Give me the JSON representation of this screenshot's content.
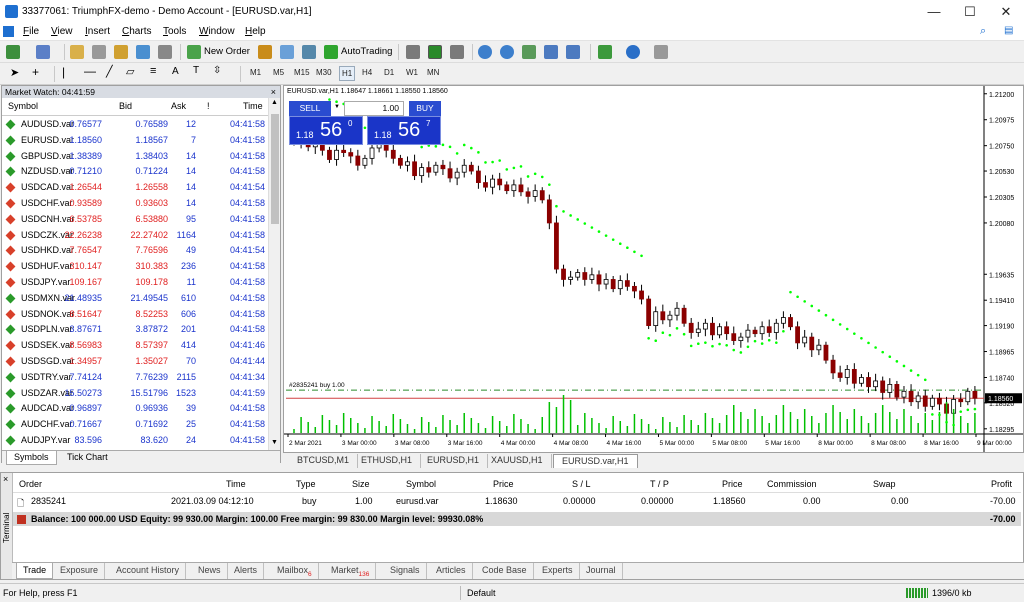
{
  "window": {
    "title": "33377061: TriumphFX-demo - Demo Account - [EURUSD.var,H1]",
    "minimize": "—",
    "maximize": "☐",
    "close": "✕"
  },
  "menu": [
    "File",
    "View",
    "Insert",
    "Charts",
    "Tools",
    "Window",
    "Help"
  ],
  "toolbar": {
    "new_order": "New Order",
    "autotrading": "AutoTrading"
  },
  "timeframes": [
    "M1",
    "M5",
    "M15",
    "M30",
    "H1",
    "H4",
    "D1",
    "W1",
    "MN"
  ],
  "market_watch": {
    "title": "Market Watch: 04:41:59",
    "close": "×",
    "columns": {
      "symbol": "Symbol",
      "bid": "Bid",
      "ask": "Ask",
      "excl": "!",
      "time": "Time"
    },
    "rows": [
      {
        "symbol": "AUDUSD.var",
        "bid": "0.76577",
        "ask": "0.76589",
        "spread": "12",
        "time": "04:41:58",
        "dir": "up"
      },
      {
        "symbol": "EURUSD.var",
        "bid": "1.18560",
        "ask": "1.18567",
        "spread": "7",
        "time": "04:41:58",
        "dir": "up"
      },
      {
        "symbol": "GBPUSD.var",
        "bid": "1.38389",
        "ask": "1.38403",
        "spread": "14",
        "time": "04:41:58",
        "dir": "up"
      },
      {
        "symbol": "NZDUSD.var",
        "bid": "0.71210",
        "ask": "0.71224",
        "spread": "14",
        "time": "04:41:58",
        "dir": "up"
      },
      {
        "symbol": "USDCAD.var",
        "bid": "1.26544",
        "ask": "1.26558",
        "spread": "14",
        "time": "04:41:54",
        "dir": "dn"
      },
      {
        "symbol": "USDCHF.var",
        "bid": "0.93589",
        "ask": "0.93603",
        "spread": "14",
        "time": "04:41:58",
        "dir": "dn"
      },
      {
        "symbol": "USDCNH.var",
        "bid": "6.53785",
        "ask": "6.53880",
        "spread": "95",
        "time": "04:41:58",
        "dir": "dn"
      },
      {
        "symbol": "USDCZK.var",
        "bid": "22.26238",
        "ask": "22.27402",
        "spread": "1164",
        "time": "04:41:58",
        "dir": "dn"
      },
      {
        "symbol": "USDHKD.var",
        "bid": "7.76547",
        "ask": "7.76596",
        "spread": "49",
        "time": "04:41:54",
        "dir": "dn"
      },
      {
        "symbol": "USDHUF.var",
        "bid": "310.147",
        "ask": "310.383",
        "spread": "236",
        "time": "04:41:58",
        "dir": "dn"
      },
      {
        "symbol": "USDJPY.var",
        "bid": "109.167",
        "ask": "109.178",
        "spread": "11",
        "time": "04:41:58",
        "dir": "dn"
      },
      {
        "symbol": "USDMXN.var",
        "bid": "21.48935",
        "ask": "21.49545",
        "spread": "610",
        "time": "04:41:58",
        "dir": "up"
      },
      {
        "symbol": "USDNOK.var",
        "bid": "8.51647",
        "ask": "8.52253",
        "spread": "606",
        "time": "04:41:58",
        "dir": "dn"
      },
      {
        "symbol": "USDPLN.var",
        "bid": "3.87671",
        "ask": "3.87872",
        "spread": "201",
        "time": "04:41:58",
        "dir": "up"
      },
      {
        "symbol": "USDSEK.var",
        "bid": "8.56983",
        "ask": "8.57397",
        "spread": "414",
        "time": "04:41:46",
        "dir": "dn"
      },
      {
        "symbol": "USDSGD.var",
        "bid": "1.34957",
        "ask": "1.35027",
        "spread": "70",
        "time": "04:41:44",
        "dir": "dn"
      },
      {
        "symbol": "USDTRY.var",
        "bid": "7.74124",
        "ask": "7.76239",
        "spread": "2115",
        "time": "04:41:34",
        "dir": "up"
      },
      {
        "symbol": "USDZAR.var",
        "bid": "15.50273",
        "ask": "15.51796",
        "spread": "1523",
        "time": "04:41:59",
        "dir": "up"
      },
      {
        "symbol": "AUDCAD.var",
        "bid": "0.96897",
        "ask": "0.96936",
        "spread": "39",
        "time": "04:41:58",
        "dir": "up"
      },
      {
        "symbol": "AUDCHF.var",
        "bid": "0.71667",
        "ask": "0.71692",
        "spread": "25",
        "time": "04:41:58",
        "dir": "up"
      },
      {
        "symbol": "AUDJPY.var",
        "bid": "83.596",
        "ask": "83.620",
        "spread": "24",
        "time": "04:41:58",
        "dir": "up"
      }
    ],
    "tabs": [
      "Symbols",
      "Tick Chart"
    ]
  },
  "chart": {
    "info": "EURUSD.var,H1  1.18647 1.18661 1.18550 1.18560",
    "one_click": {
      "sell": "SELL",
      "buy": "BUY",
      "lot": "1.00",
      "sell_small": "1.18",
      "sell_big": "56",
      "sell_sup": "0",
      "buy_small": "1.18",
      "buy_big": "56",
      "buy_sup": "7"
    },
    "order_line_label": "#2835241 buy 1.00",
    "price_labels": [
      "1.21200",
      "1.20975",
      "1.20750",
      "1.20530",
      "1.20305",
      "1.20080",
      "1.19635",
      "1.19410",
      "1.19190",
      "1.18965",
      "1.18740",
      "1.18520",
      "1.18295"
    ],
    "current_price": "1.18560",
    "time_labels": [
      "2 Mar 2021",
      "3 Mar 00:00",
      "3 Mar 08:00",
      "3 Mar 16:00",
      "4 Mar 00:00",
      "4 Mar 08:00",
      "4 Mar 16:00",
      "5 Mar 00:00",
      "5 Mar 08:00",
      "5 Mar 16:00",
      "8 Mar 00:00",
      "8 Mar 08:00",
      "8 Mar 16:00",
      "9 Mar 00:00"
    ],
    "tabs": [
      "BTCUSD,M1",
      "ETHUSD,H1",
      "EURUSD,H1",
      "XAUUSD,H1",
      "EURUSD.var,H1"
    ],
    "active_tab": "EURUSD.var,H1"
  },
  "chart_data": {
    "type": "candlestick",
    "ylim": [
      1.1825,
      1.2125
    ],
    "y_ticks": [
      1.212,
      1.20975,
      1.2075,
      1.2053,
      1.20305,
      1.2008,
      1.19635,
      1.1941,
      1.1919,
      1.18965,
      1.1874,
      1.1852,
      1.18295
    ],
    "price_line": 1.1856,
    "order_line": 1.1863,
    "closes": [
      1.2078,
      1.2082,
      1.2074,
      1.2079,
      1.2071,
      1.2063,
      1.2071,
      1.2069,
      1.2066,
      1.2058,
      1.2064,
      1.2073,
      1.2076,
      1.2071,
      1.2064,
      1.2058,
      1.2061,
      1.2049,
      1.2056,
      1.2052,
      1.2058,
      1.2055,
      1.2047,
      1.2052,
      1.2058,
      1.2053,
      1.2043,
      1.2039,
      1.2046,
      1.2041,
      1.2036,
      1.2041,
      1.2035,
      1.2031,
      1.2036,
      1.2028,
      1.2008,
      1.1968,
      1.1959,
      1.1961,
      1.1965,
      1.1959,
      1.1963,
      1.1955,
      1.1959,
      1.1951,
      1.1958,
      1.1953,
      1.1949,
      1.1942,
      1.1919,
      1.1931,
      1.1924,
      1.1928,
      1.1934,
      1.1921,
      1.1913,
      1.1916,
      1.1921,
      1.1911,
      1.1918,
      1.1912,
      1.1906,
      1.1909,
      1.1915,
      1.1912,
      1.1918,
      1.1913,
      1.1921,
      1.1926,
      1.1918,
      1.1904,
      1.1909,
      1.1898,
      1.1902,
      1.1889,
      1.1878,
      1.1874,
      1.1881,
      1.1869,
      1.1874,
      1.1866,
      1.1871,
      1.1861,
      1.1868,
      1.1857,
      1.1862,
      1.1853,
      1.1858,
      1.1849,
      1.1856,
      1.1851,
      1.1843,
      1.1855,
      1.1853,
      1.1862,
      1.1856
    ]
  },
  "terminal": {
    "side_label": "Terminal",
    "close": "×",
    "columns": [
      "Order",
      "Time",
      "Type",
      "Size",
      "Symbol",
      "Price",
      "S / L",
      "T / P",
      "Price",
      "Commission",
      "Swap",
      "Profit"
    ],
    "order": {
      "order": "2835241",
      "time": "2021.03.09 04:12:10",
      "type": "buy",
      "size": "1.00",
      "symbol": "eurusd.var",
      "price": "1.18630",
      "sl": "0.00000",
      "tp": "0.00000",
      "price2": "1.18560",
      "commission": "0.00",
      "swap": "0.00",
      "profit": "-70.00"
    },
    "balance": "Balance: 100 000.00 USD  Equity: 99 930.00  Margin: 100.00  Free margin: 99 830.00  Margin level: 99930.08%",
    "balance_profit": "-70.00",
    "tabs": [
      {
        "label": "Trade",
        "badge": ""
      },
      {
        "label": "Exposure",
        "badge": ""
      },
      {
        "label": "Account History",
        "badge": ""
      },
      {
        "label": "News",
        "badge": ""
      },
      {
        "label": "Alerts",
        "badge": ""
      },
      {
        "label": "Mailbox",
        "badge": "6"
      },
      {
        "label": "Market",
        "badge": "136"
      },
      {
        "label": "Signals",
        "badge": ""
      },
      {
        "label": "Articles",
        "badge": ""
      },
      {
        "label": "Code Base",
        "badge": ""
      },
      {
        "label": "Experts",
        "badge": ""
      },
      {
        "label": "Journal",
        "badge": ""
      }
    ]
  },
  "status": {
    "help": "For Help, press F1",
    "profile": "Default",
    "traffic": "1396/0 kb"
  },
  "colors": {
    "accent": "#1a35c8",
    "up": "#1a33cc",
    "down": "#e02020",
    "sar": "#00ff00",
    "bull": "#000000",
    "bear": "#8b0000"
  }
}
